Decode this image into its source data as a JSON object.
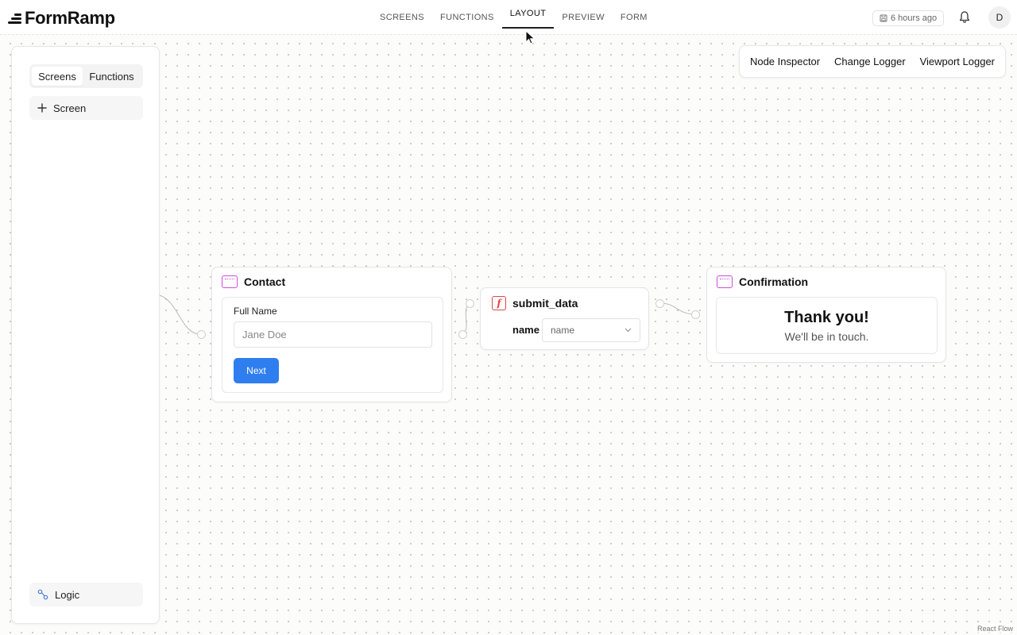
{
  "app": {
    "brand": "FormRamp"
  },
  "nav": [
    {
      "label": "SCREENS",
      "active": false
    },
    {
      "label": "FUNCTIONS",
      "active": false
    },
    {
      "label": "LAYOUT",
      "active": true
    },
    {
      "label": "PREVIEW",
      "active": false
    },
    {
      "label": "FORM",
      "active": false
    }
  ],
  "header": {
    "saved_status": "6 hours ago",
    "avatar_initial": "D"
  },
  "sidebar": {
    "tabs": [
      "Screens",
      "Functions"
    ],
    "add_screen_label": "Screen",
    "logic_label": "Logic"
  },
  "dev_tools": [
    "Node Inspector",
    "Change Logger",
    "Viewport Logger"
  ],
  "nodes": {
    "contact": {
      "title": "Contact",
      "field_label": "Full Name",
      "field_placeholder": "Jane Doe",
      "button_label": "Next"
    },
    "function": {
      "title": "submit_data",
      "param_label": "name",
      "param_value": "name"
    },
    "confirmation": {
      "title": "Confirmation",
      "heading": "Thank you!",
      "subtext": "We'll be in touch."
    }
  },
  "attribution": "React Flow",
  "colors": {
    "primary_button": "#2f7ef0",
    "screen_icon": "#d14bd9",
    "function_icon": "#e0454a"
  }
}
